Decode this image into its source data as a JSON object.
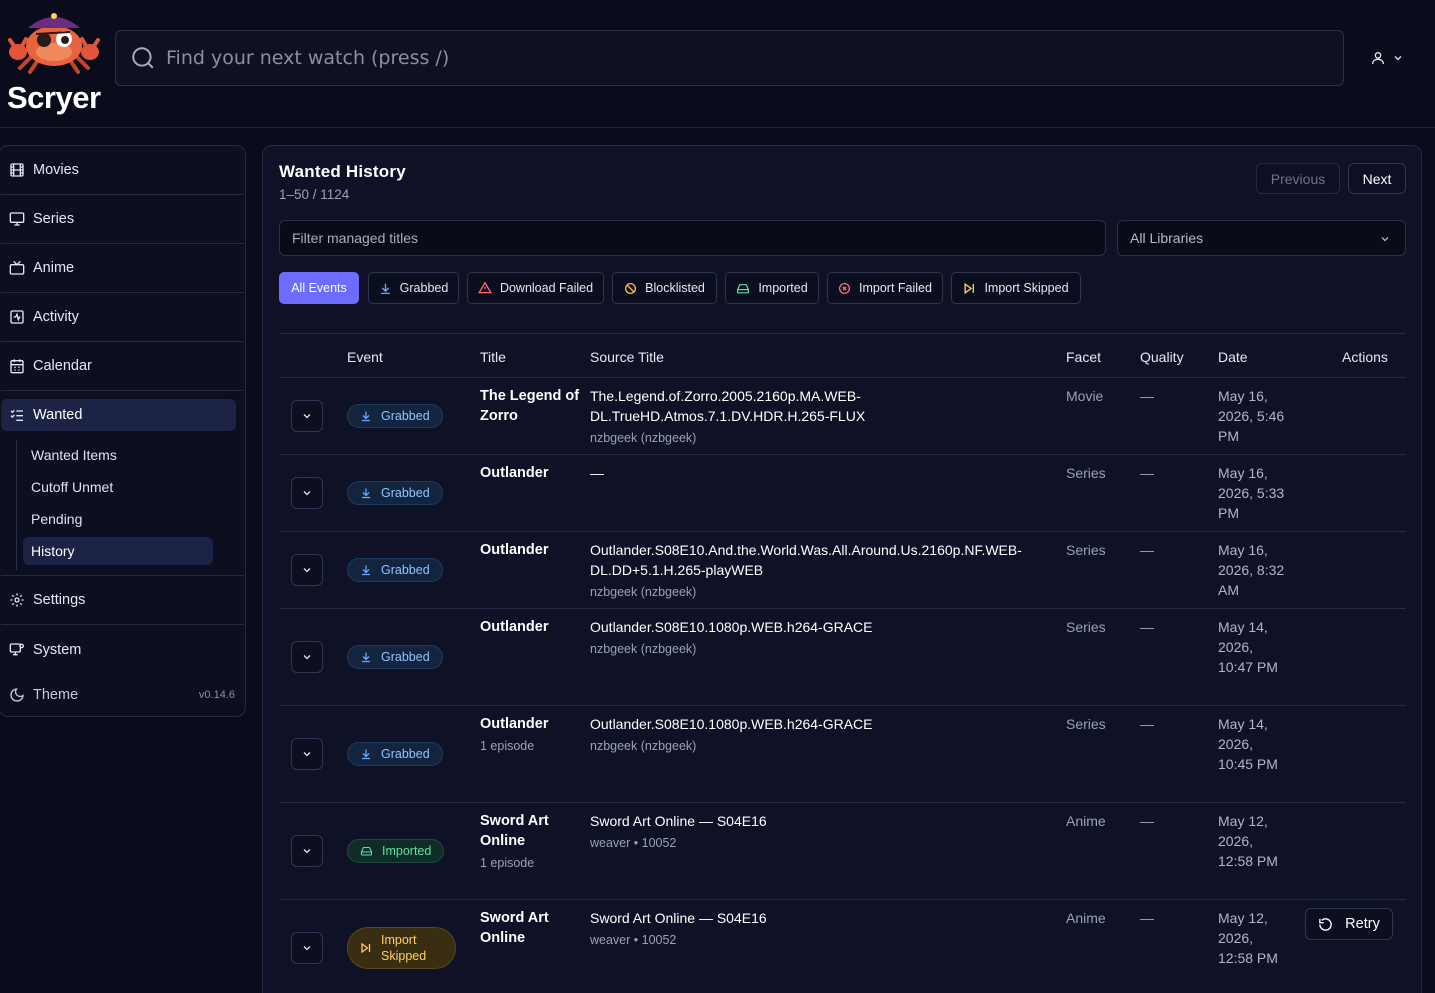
{
  "app": {
    "name": "Scryer",
    "search_placeholder": "Find your next watch (press /)"
  },
  "sidebar": {
    "items": [
      {
        "label": "Movies",
        "icon": "film-icon"
      },
      {
        "label": "Series",
        "icon": "monitor-icon"
      },
      {
        "label": "Anime",
        "icon": "tv-icon"
      },
      {
        "label": "Activity",
        "icon": "activity-icon"
      },
      {
        "label": "Calendar",
        "icon": "calendar-icon"
      },
      {
        "label": "Wanted",
        "icon": "list-check-icon"
      }
    ],
    "wanted_sub": [
      "Wanted Items",
      "Cutoff Unmet",
      "Pending",
      "History"
    ],
    "settings": "Settings",
    "system": "System",
    "theme": "Theme",
    "version": "v0.14.6"
  },
  "main": {
    "title": "Wanted History",
    "count": "1–50 / 1124",
    "prev_label": "Previous",
    "next_label": "Next",
    "filter_placeholder": "Filter managed titles",
    "library_select": "All Libraries",
    "chips": [
      "All Events",
      "Grabbed",
      "Download Failed",
      "Blocklisted",
      "Imported",
      "Import Failed",
      "Import Skipped"
    ],
    "columns": [
      "Event",
      "Title",
      "Source Title",
      "Facet",
      "Quality",
      "Date",
      "Actions"
    ]
  },
  "colors": {
    "accent": "#6c6cff",
    "grabbed": "#8ec5ff",
    "imported": "#5ee0a9",
    "skipped": "#ffd15a",
    "failed": "#ff6b6b"
  },
  "rows": [
    {
      "event": "Grabbed",
      "title": "The Legend of Zorro",
      "title_sub": "",
      "source": "The.Legend.of.Zorro.2005.2160p.MA.WEB-DL.TrueHD.Atmos.7.1.DV.HDR.H.265-FLUX",
      "indexer": "nzbgeek (nzbgeek)",
      "facet": "Movie",
      "quality": "—",
      "date": "May 16, 2026, 5:46 PM"
    },
    {
      "event": "Grabbed",
      "title": "Outlander",
      "title_sub": "",
      "source": "—",
      "indexer": "",
      "facet": "Series",
      "quality": "—",
      "date": "May 16, 2026, 5:33 PM"
    },
    {
      "event": "Grabbed",
      "title": "Outlander",
      "title_sub": "",
      "source": "Outlander.S08E10.And.the.World.Was.All.Around.Us.2160p.NF.WEB-DL.DD+5.1.H.265-playWEB",
      "indexer": "nzbgeek (nzbgeek)",
      "facet": "Series",
      "quality": "—",
      "date": "May 16, 2026, 8:32 AM"
    },
    {
      "event": "Grabbed",
      "title": "Outlander",
      "title_sub": "",
      "source": "Outlander.S08E10.1080p.WEB.h264-GRACE",
      "indexer": "nzbgeek (nzbgeek)",
      "facet": "Series",
      "quality": "—",
      "date": "May 14, 2026, 10:47 PM"
    },
    {
      "event": "Grabbed",
      "title": "Outlander",
      "title_sub": "1 episode",
      "source": "Outlander.S08E10.1080p.WEB.h264-GRACE",
      "indexer": "nzbgeek (nzbgeek)",
      "facet": "Series",
      "quality": "—",
      "date": "May 14, 2026, 10:45 PM"
    },
    {
      "event": "Imported",
      "title": "Sword Art Online",
      "title_sub": "1 episode",
      "source": "Sword Art Online — S04E16",
      "indexer": "weaver • 10052",
      "facet": "Anime",
      "quality": "—",
      "date": "May 12, 2026, 12:58 PM"
    },
    {
      "event": "Import Skipped",
      "title": "Sword Art Online",
      "title_sub": "",
      "source": "Sword Art Online — S04E16",
      "indexer": "weaver • 10052",
      "facet": "Anime",
      "quality": "—",
      "date": "May 12, 2026, 12:58 PM",
      "action": "Retry"
    }
  ]
}
